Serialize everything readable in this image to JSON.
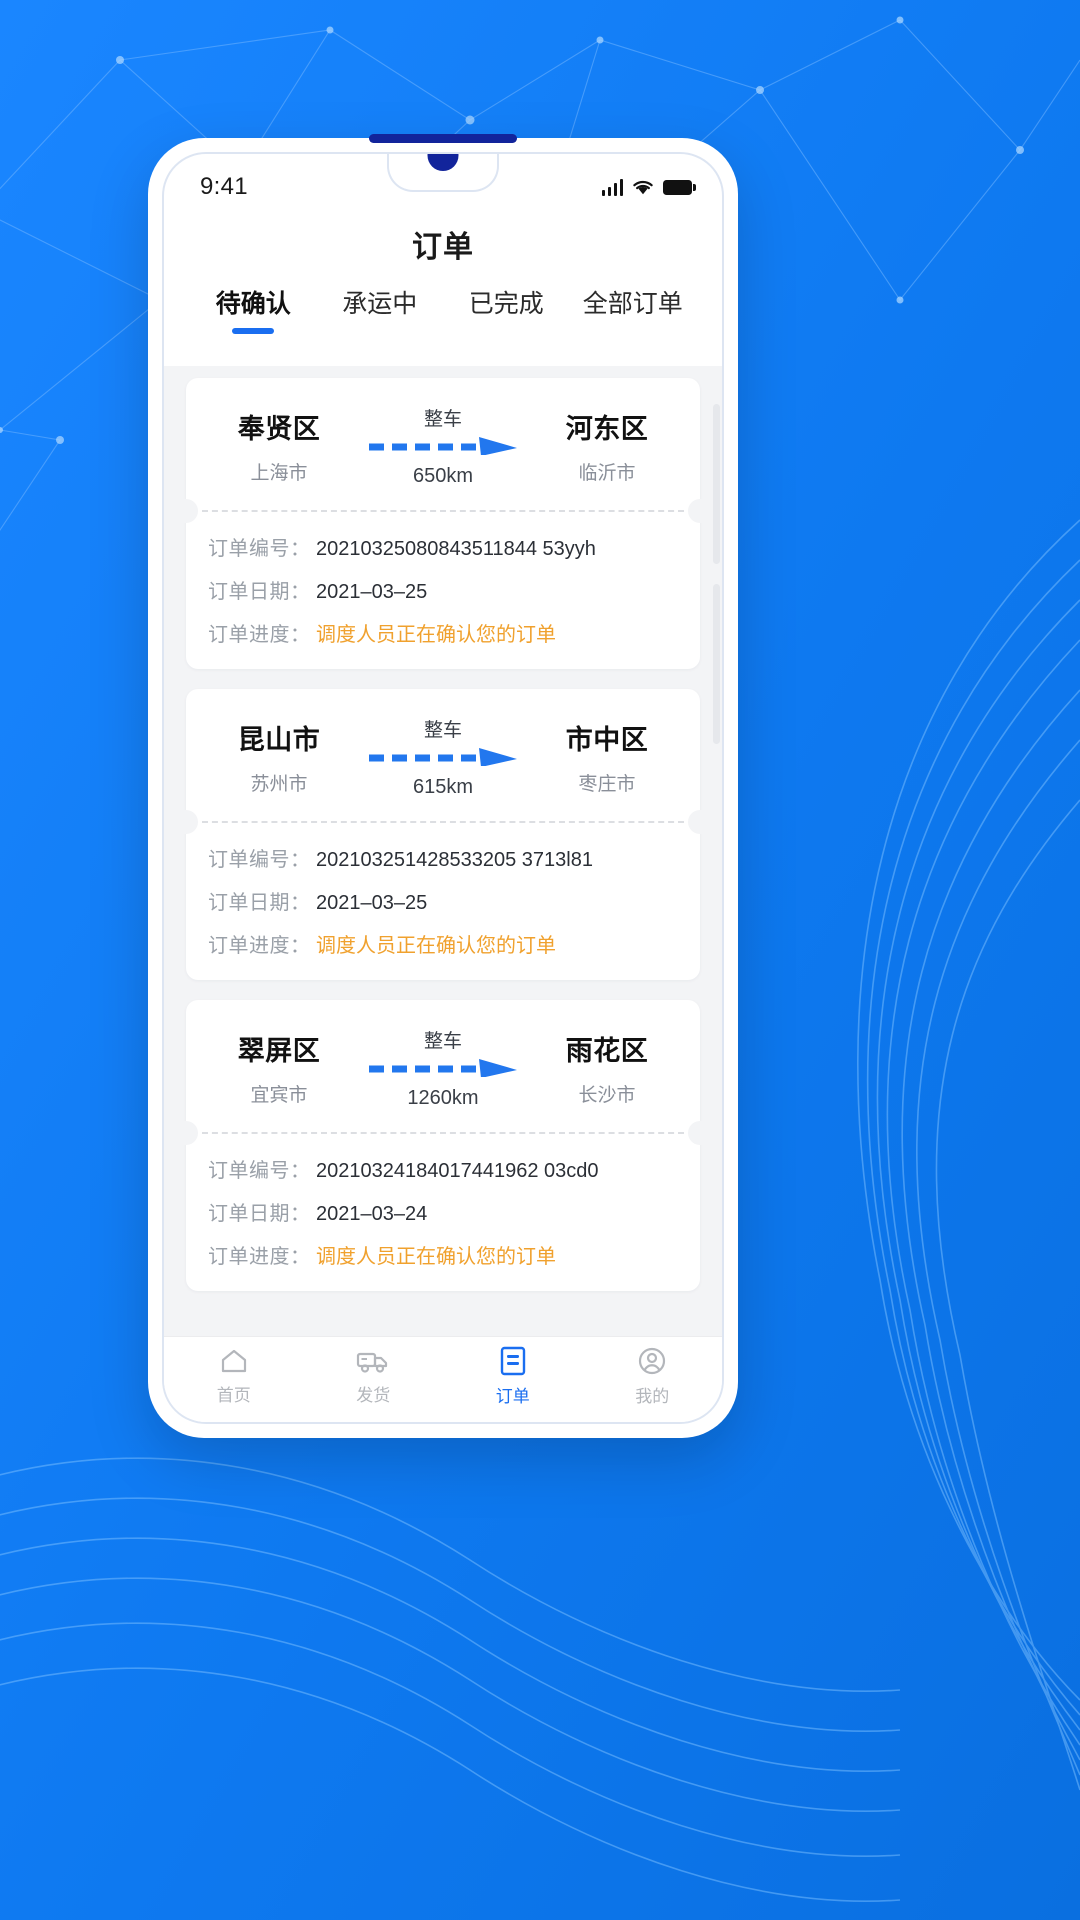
{
  "theme": {
    "background": "#1180f5",
    "accent": "#1a6ef0",
    "notch_blue": "#12249b",
    "status_orange": "#f0a12e",
    "list_bg": "#f3f4f6"
  },
  "status_bar": {
    "time": "9:41",
    "signal_icon": "cellular-signal-icon",
    "wifi_icon": "wifi-icon",
    "battery_icon": "battery-icon"
  },
  "header": {
    "title": "订单"
  },
  "tabs": [
    {
      "label": "待确认",
      "active": true
    },
    {
      "label": "承运中",
      "active": false
    },
    {
      "label": "已完成",
      "active": false
    },
    {
      "label": "全部订单",
      "active": false
    }
  ],
  "labels": {
    "order_no": "订单编号：",
    "order_date": "订单日期：",
    "order_progress": "订单进度："
  },
  "orders": [
    {
      "origin_city": "奉贤区",
      "origin_province": "上海市",
      "mode": "整车",
      "distance": "650km",
      "dest_city": "河东区",
      "dest_province": "临沂市",
      "order_no": "20210325080843511844 53yyh",
      "order_date": "2021–03–25",
      "progress": "调度人员正在确认您的订单"
    },
    {
      "origin_city": "昆山市",
      "origin_province": "苏州市",
      "mode": "整车",
      "distance": "615km",
      "dest_city": "市中区",
      "dest_province": "枣庄市",
      "order_no": "202103251428533205 3713l81",
      "order_date": "2021–03–25",
      "progress": "调度人员正在确认您的订单"
    },
    {
      "origin_city": "翠屏区",
      "origin_province": "宜宾市",
      "mode": "整车",
      "distance": "1260km",
      "dest_city": "雨花区",
      "dest_province": "长沙市",
      "order_no": "20210324184017441962 03cd0",
      "order_date": "2021–03–24",
      "progress": "调度人员正在确认您的订单"
    }
  ],
  "bottom_nav": [
    {
      "label": "首页",
      "icon": "home-icon",
      "active": false
    },
    {
      "label": "发货",
      "icon": "truck-icon",
      "active": false
    },
    {
      "label": "订单",
      "icon": "order-list-icon",
      "active": true
    },
    {
      "label": "我的",
      "icon": "user-icon",
      "active": false
    }
  ]
}
